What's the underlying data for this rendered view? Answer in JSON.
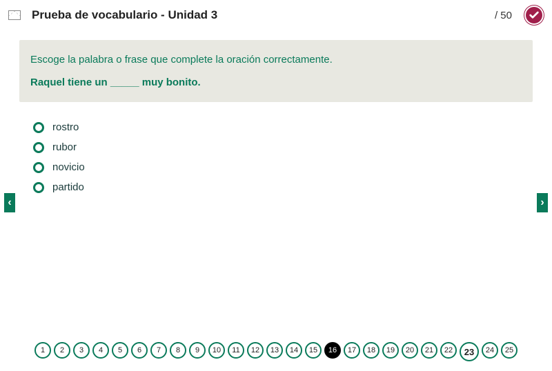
{
  "header": {
    "title": "Prueba de vocabulario - Unidad 3",
    "score_suffix": "/ 50"
  },
  "question": {
    "instruction": "Escoge la palabra o frase que complete la oración correctamente.",
    "prompt": "Raquel tiene un _____ muy bonito."
  },
  "options": [
    {
      "label": "rostro"
    },
    {
      "label": "rubor"
    },
    {
      "label": "novicio"
    },
    {
      "label": "partido"
    }
  ],
  "nav": {
    "prev_glyph": "‹",
    "next_glyph": "›"
  },
  "pager": {
    "pages": [
      1,
      2,
      3,
      4,
      5,
      6,
      7,
      8,
      9,
      10,
      11,
      12,
      13,
      14,
      15,
      16,
      17,
      18,
      19,
      20,
      21,
      22,
      23,
      24,
      25
    ],
    "current": 16,
    "highlight": 23
  }
}
